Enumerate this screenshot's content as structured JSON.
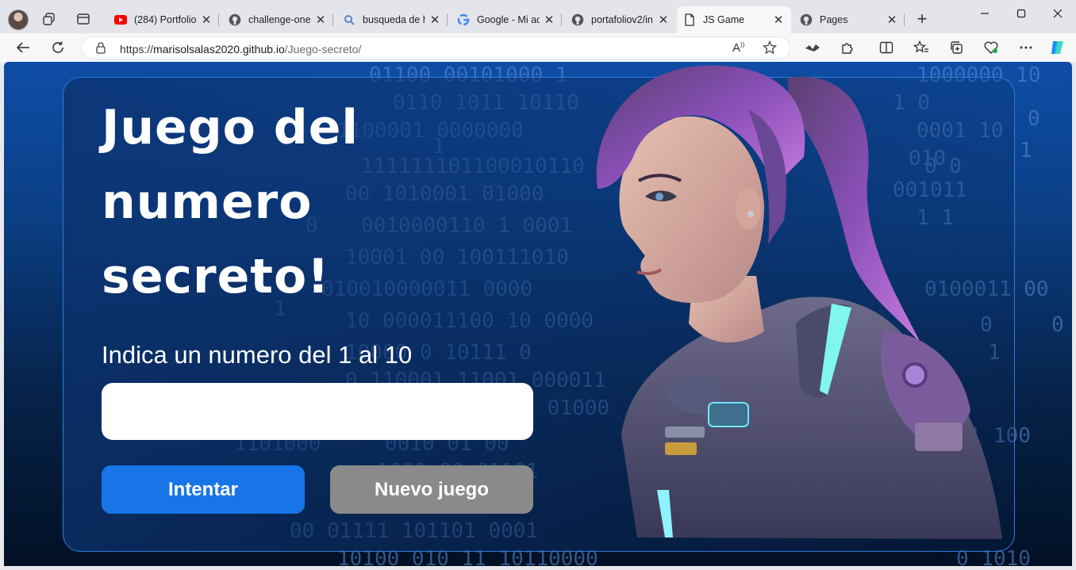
{
  "browser": {
    "tabs": [
      {
        "title": "(284) Portfolio",
        "icon": "youtube-icon"
      },
      {
        "title": "challenge-one-",
        "icon": "github-icon"
      },
      {
        "title": "busqueda de h",
        "icon": "search-icon"
      },
      {
        "title": "Google - Mi ac",
        "icon": "google-icon"
      },
      {
        "title": "portafoliov2/in",
        "icon": "github-icon"
      },
      {
        "title": "JS Game",
        "icon": "document-icon",
        "active": true
      },
      {
        "title": "Pages",
        "icon": "github-icon"
      }
    ],
    "address": {
      "protocol": "https://",
      "host": "marisolsalas2020.github.io",
      "path": "/Juego-secreto/"
    },
    "reader_icon_label": "A"
  },
  "page": {
    "title_line1": "Juego del",
    "title_line2": "numero",
    "title_line3": "secreto!",
    "instruction": "Indica un numero del 1 al 10",
    "input_value": "",
    "try_button": "Intentar",
    "new_game_button": "Nuevo juego"
  },
  "colors": {
    "primary_button": "#1875e8",
    "secondary_button": "#8a8a8a",
    "card_border": "#2f7cd8",
    "background_top": "#0e4da6",
    "background_bottom": "#021025"
  }
}
